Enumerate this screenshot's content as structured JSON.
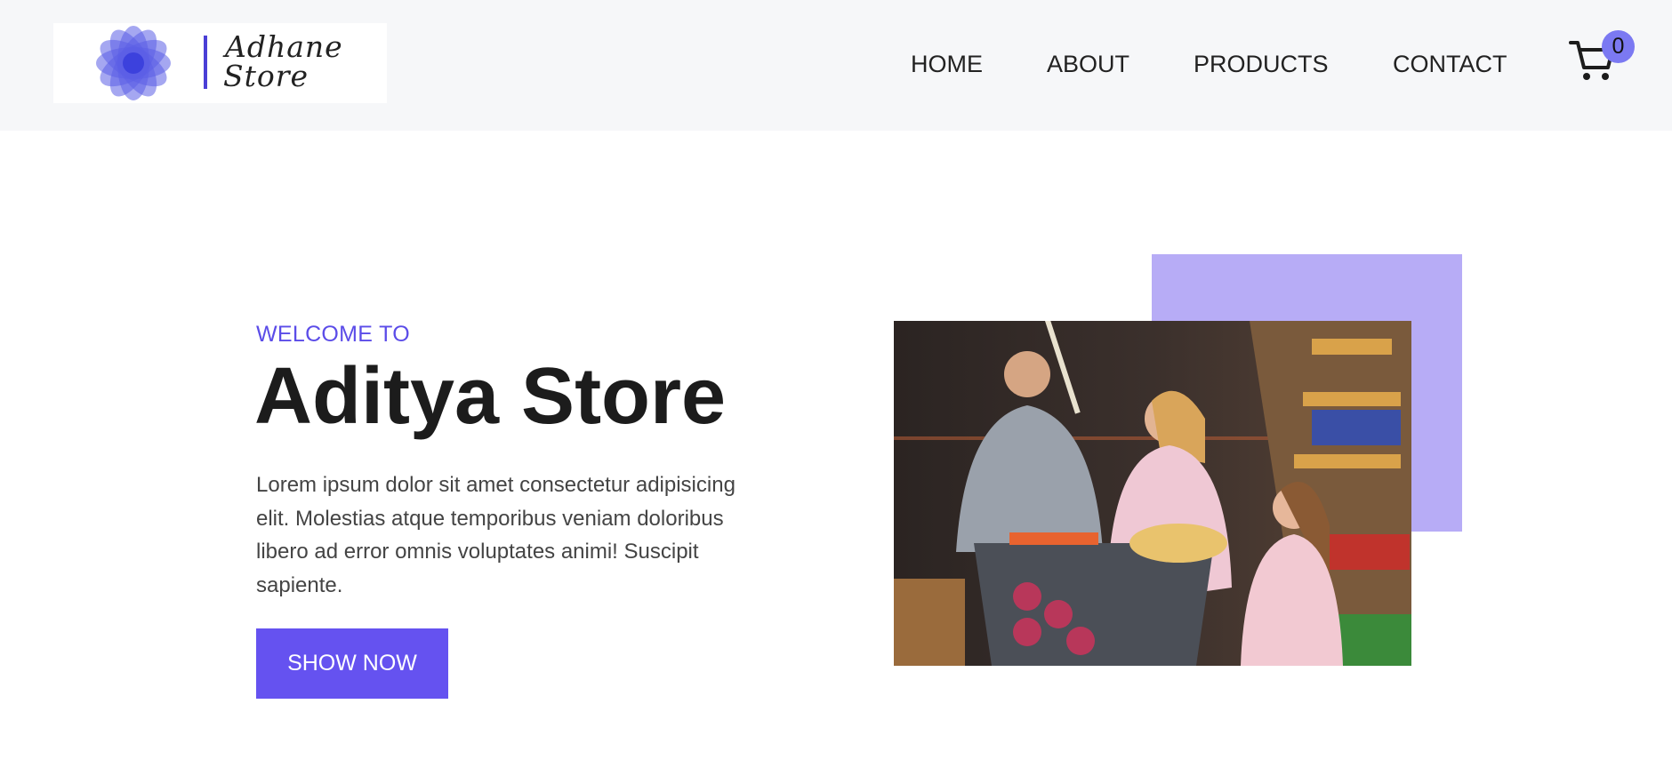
{
  "header": {
    "logo": {
      "text_line1": "Adhane",
      "text_line2": "Store",
      "icon": "lotus-flower-icon",
      "color": "#4a3fd6"
    },
    "nav": [
      {
        "label": "HOME"
      },
      {
        "label": "ABOUT"
      },
      {
        "label": "PRODUCTS"
      },
      {
        "label": "CONTACT"
      }
    ],
    "cart": {
      "icon": "shopping-cart-icon",
      "count": "0",
      "badge_color": "#7b79f2"
    }
  },
  "hero": {
    "eyebrow": "WELCOME TO",
    "title": "Aditya Store",
    "description": "Lorem ipsum dolor sit amet consectetur adipisicing elit. Molestias atque temporibus veniam doloribus libero ad error omnis voluptates animi! Suscipit sapiente.",
    "cta_label": "SHOW NOW",
    "accent_color": "#6552f0",
    "accent_box_color": "#b7acf6",
    "image": "family-shopping-in-supermarket-photo"
  }
}
